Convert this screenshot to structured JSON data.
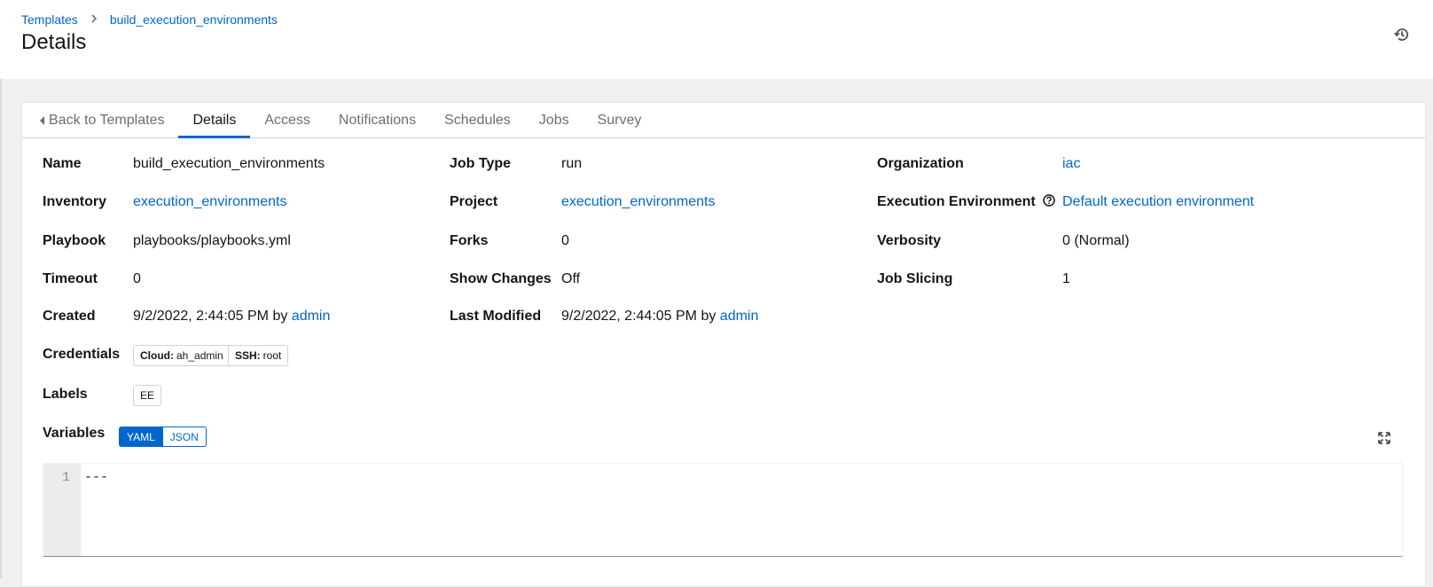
{
  "breadcrumb": [
    "Templates",
    "build_execution_environments"
  ],
  "page_title": "Details",
  "tabs": [
    {
      "label": "Back to Templates"
    },
    {
      "label": "Details",
      "active": true
    },
    {
      "label": "Access"
    },
    {
      "label": "Notifications"
    },
    {
      "label": "Schedules"
    },
    {
      "label": "Jobs"
    },
    {
      "label": "Survey"
    }
  ],
  "details": {
    "name": {
      "label": "Name",
      "value": "build_execution_environments"
    },
    "inventory": {
      "label": "Inventory",
      "value": "execution_environments"
    },
    "playbook": {
      "label": "Playbook",
      "value": "playbooks/playbooks.yml"
    },
    "timeout": {
      "label": "Timeout",
      "value": "0"
    },
    "created": {
      "label": "Created",
      "value": "9/2/2022, 2:44:05 PM by",
      "user": "admin"
    },
    "credentials": {
      "label": "Credentials",
      "items": [
        {
          "kind": "Cloud:",
          "name": "ah_admin"
        },
        {
          "kind": "SSH:",
          "name": "root"
        }
      ]
    },
    "labels": {
      "label": "Labels",
      "items": [
        "EE"
      ]
    },
    "variables": {
      "label": "Variables",
      "modes": [
        "YAML",
        "JSON"
      ],
      "selected": "YAML"
    },
    "job_type": {
      "label": "Job Type",
      "value": "run"
    },
    "project": {
      "label": "Project",
      "value": "execution_environments"
    },
    "forks": {
      "label": "Forks",
      "value": "0"
    },
    "show_changes": {
      "label": "Show Changes",
      "value": "Off"
    },
    "last_modified": {
      "label": "Last Modified",
      "value": "9/2/2022, 2:44:05 PM by",
      "user": "admin"
    },
    "organization": {
      "label": "Organization",
      "value": "iac"
    },
    "execution_environment": {
      "label": "Execution Environment",
      "value": "Default execution environment"
    },
    "verbosity": {
      "label": "Verbosity",
      "value": "0 (Normal)"
    },
    "job_slicing": {
      "label": "Job Slicing",
      "value": "1"
    }
  },
  "editor": {
    "line_numbers": [
      "1"
    ],
    "content": "---"
  },
  "icons": {
    "history": "history-icon",
    "help": "question-circle-icon",
    "expand": "expand-icon",
    "back_caret": "caret-left-icon",
    "breadcrumb_separator": "chevron-right-icon"
  },
  "colors": {
    "link": "#0066cc",
    "active_tab_underline": "#0066cc",
    "background": "#f0f0f0"
  }
}
